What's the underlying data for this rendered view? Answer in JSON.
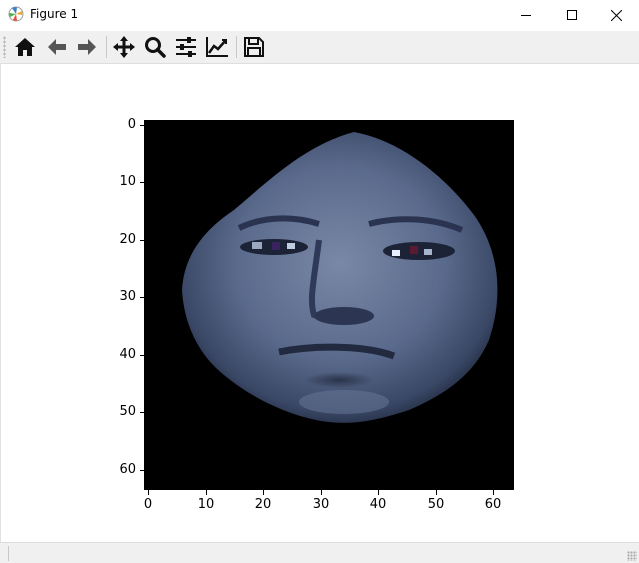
{
  "window": {
    "title": "Figure 1",
    "icon": "matplotlib-logo-icon",
    "controls": [
      "minimize-icon",
      "maximize-icon",
      "close-icon"
    ]
  },
  "toolbar": {
    "buttons": [
      {
        "name": "home",
        "icon": "home-icon"
      },
      {
        "name": "back",
        "icon": "arrow-left-icon"
      },
      {
        "name": "forward",
        "icon": "arrow-right-icon"
      },
      {
        "name": "pan",
        "icon": "move-arrows-icon"
      },
      {
        "name": "zoom",
        "icon": "magnifier-icon"
      },
      {
        "name": "configure-subplots",
        "icon": "sliders-icon"
      },
      {
        "name": "edit-axes",
        "icon": "line-chart-icon"
      },
      {
        "name": "save",
        "icon": "floppy-disk-icon"
      }
    ]
  },
  "figure": {
    "image_description_colormap": "bone-like bluish grayscale",
    "y_ticks": [
      "0",
      "10",
      "20",
      "30",
      "40",
      "50",
      "60"
    ],
    "x_ticks": [
      "0",
      "10",
      "20",
      "30",
      "40",
      "50",
      "60"
    ],
    "image_size_units": 64
  },
  "status": {
    "text": ""
  }
}
